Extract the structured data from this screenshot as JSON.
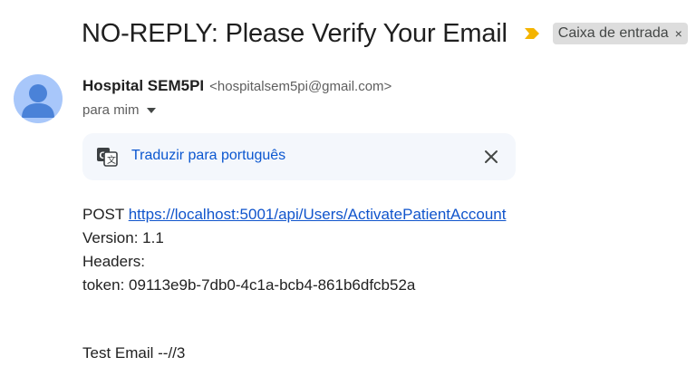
{
  "email": {
    "subject": "NO-REPLY: Please Verify Your Email",
    "importance_icon": "importance-marker-icon",
    "label": {
      "name": "Caixa de entrada",
      "close_glyph": "×"
    },
    "sender": {
      "name": "Hospital SEM5PI",
      "email": "<hospitalsem5pi@gmail.com>",
      "avatar_icon": "person-avatar-icon"
    },
    "recipient_text": "para mim",
    "translate": {
      "link_text": "Traduzir para português",
      "icon": "translate-icon",
      "close_icon": "close-icon"
    },
    "body": {
      "method": "POST",
      "url": "https://localhost:5001/api/Users/ActivatePatientAccount",
      "version_line": "Version: 1.1",
      "headers_line": "Headers:",
      "token_line": "token: 09113e9b-7db0-4c1a-bcb4-861b6dfcb52a",
      "signature": "Test Email --//3"
    }
  },
  "colors": {
    "importance": "#f4b400",
    "avatar_bg": "#a8c7fa",
    "avatar_fg": "#4a82d8",
    "link": "#1155cc",
    "translate_link": "#0b57d0",
    "translate_bg": "#f4f7fc",
    "label_bg": "#dddddd"
  }
}
